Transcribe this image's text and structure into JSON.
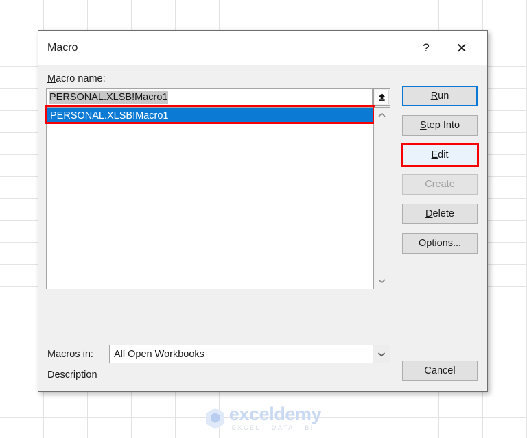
{
  "background": {
    "app": "excel-worksheet-grid",
    "gridline_color": "#e2e2e2"
  },
  "watermark": {
    "brand": "exceldemy",
    "tagline": "EXCEL · DATA · BI",
    "color": "#c9d9f2"
  },
  "dialog": {
    "title": "Macro",
    "help_label": "?",
    "close_label": "✕",
    "macro_name_label_pre": "M",
    "macro_name_label_post": "acro name:",
    "macro_name_value": "PERSONAL.XLSB!Macro1",
    "macro_name_placeholder": "Macro name",
    "up_button_label": "⬆",
    "list_items": [
      "PERSONAL.XLSB!Macro1"
    ],
    "scroll_up_label": "⌃",
    "scroll_down_label": "⌄",
    "macros_in_label_pre": "M",
    "macros_in_label_acc": "a",
    "macros_in_label_post": "cros in:",
    "macros_in_value": "All Open Workbooks",
    "macros_in_options": [
      "All Open Workbooks"
    ],
    "macros_in_arrow": "⌄",
    "description_label": "Description",
    "description_value": "",
    "buttons": {
      "run": {
        "pre": "",
        "acc": "R",
        "post": "un",
        "state": "focused"
      },
      "step_into": {
        "pre": "",
        "acc": "S",
        "post": "tep Into",
        "state": "normal"
      },
      "edit": {
        "pre": "",
        "acc": "E",
        "post": "dit",
        "state": "hover"
      },
      "create": {
        "pre": "",
        "acc": "",
        "post": "Create",
        "state": "disabled"
      },
      "delete": {
        "pre": "",
        "acc": "D",
        "post": "elete",
        "state": "normal"
      },
      "options": {
        "pre": "",
        "acc": "O",
        "post": "ptions...",
        "state": "normal"
      },
      "cancel": {
        "pre": "",
        "acc": "",
        "post": "Cancel",
        "state": "normal"
      }
    }
  },
  "annotations": {
    "selected_list_item_box_color": "#f90000",
    "edit_button_box_color": "#f90000",
    "focus_border_color": "#0a77d5",
    "selection_color": "#0b7ad4"
  }
}
